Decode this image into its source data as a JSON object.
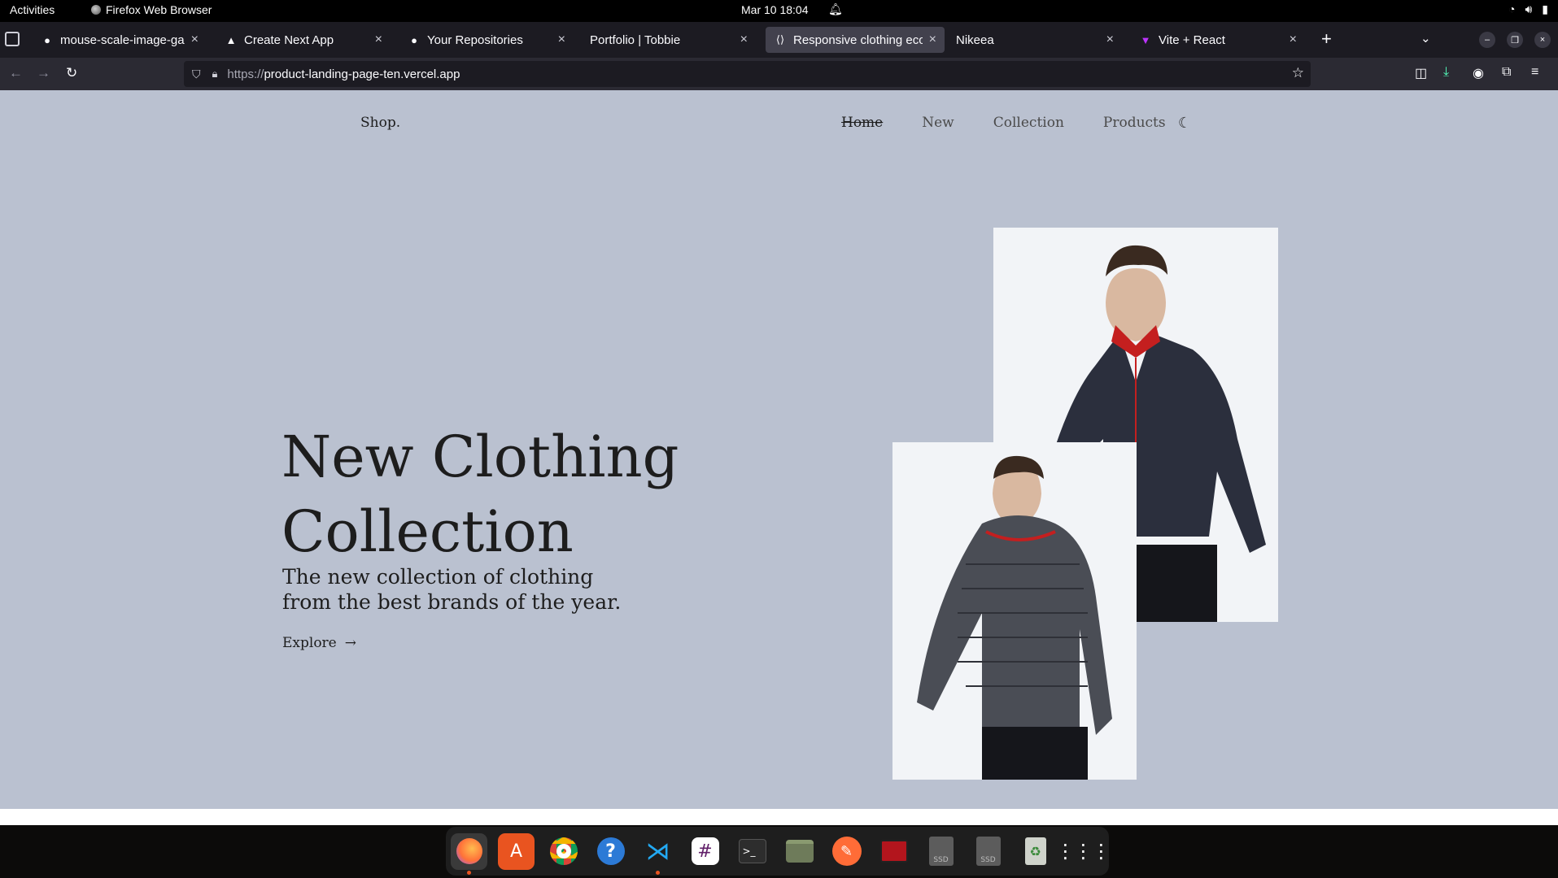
{
  "system_bar": {
    "activities": "Activities",
    "app_name": "Firefox Web Browser",
    "datetime": "Mar 10  18:04"
  },
  "browser": {
    "tabs": [
      {
        "label": "mouse-scale-image-galle",
        "icon": "github-icon",
        "active": false
      },
      {
        "label": "Create Next App",
        "icon": "triangle-icon",
        "active": false
      },
      {
        "label": "Your Repositories",
        "icon": "github-icon",
        "active": false
      },
      {
        "label": "Portfolio | Tobbie",
        "icon": "",
        "active": false
      },
      {
        "label": "Responsive clothing econ",
        "icon": "code-icon",
        "active": true
      },
      {
        "label": "Nikeea",
        "icon": "",
        "active": false
      },
      {
        "label": "Vite + React",
        "icon": "vite-icon",
        "active": false
      }
    ],
    "url_prefix": "https://",
    "url_host": "product-landing-page-ten.vercel.app"
  },
  "page": {
    "brand": "Shop.",
    "nav": [
      "Home",
      "New",
      "Collection",
      "Products"
    ],
    "hero_title": "New Clothing Collection",
    "hero_description": "The new collection of clothing from the best brands of the year.",
    "cta": "Explore",
    "background_color": "#bac1d0"
  },
  "dock": {
    "apps": [
      {
        "name": "firefox-icon",
        "running": true
      },
      {
        "name": "app-center-icon",
        "running": false
      },
      {
        "name": "chrome-icon",
        "running": false
      },
      {
        "name": "help-icon",
        "running": false
      },
      {
        "name": "vscode-icon",
        "running": true
      },
      {
        "name": "slack-icon",
        "running": false
      },
      {
        "name": "terminal-icon",
        "running": false
      },
      {
        "name": "files-icon",
        "running": false
      },
      {
        "name": "postman-icon",
        "running": false
      },
      {
        "name": "screenshot-icon",
        "running": false
      },
      {
        "name": "ssd-drive-icon",
        "running": false,
        "label": "SSD"
      },
      {
        "name": "ssd-drive-icon",
        "running": false,
        "label": "SSD"
      },
      {
        "name": "trash-icon",
        "running": false
      },
      {
        "name": "show-apps-icon",
        "running": false
      }
    ]
  }
}
